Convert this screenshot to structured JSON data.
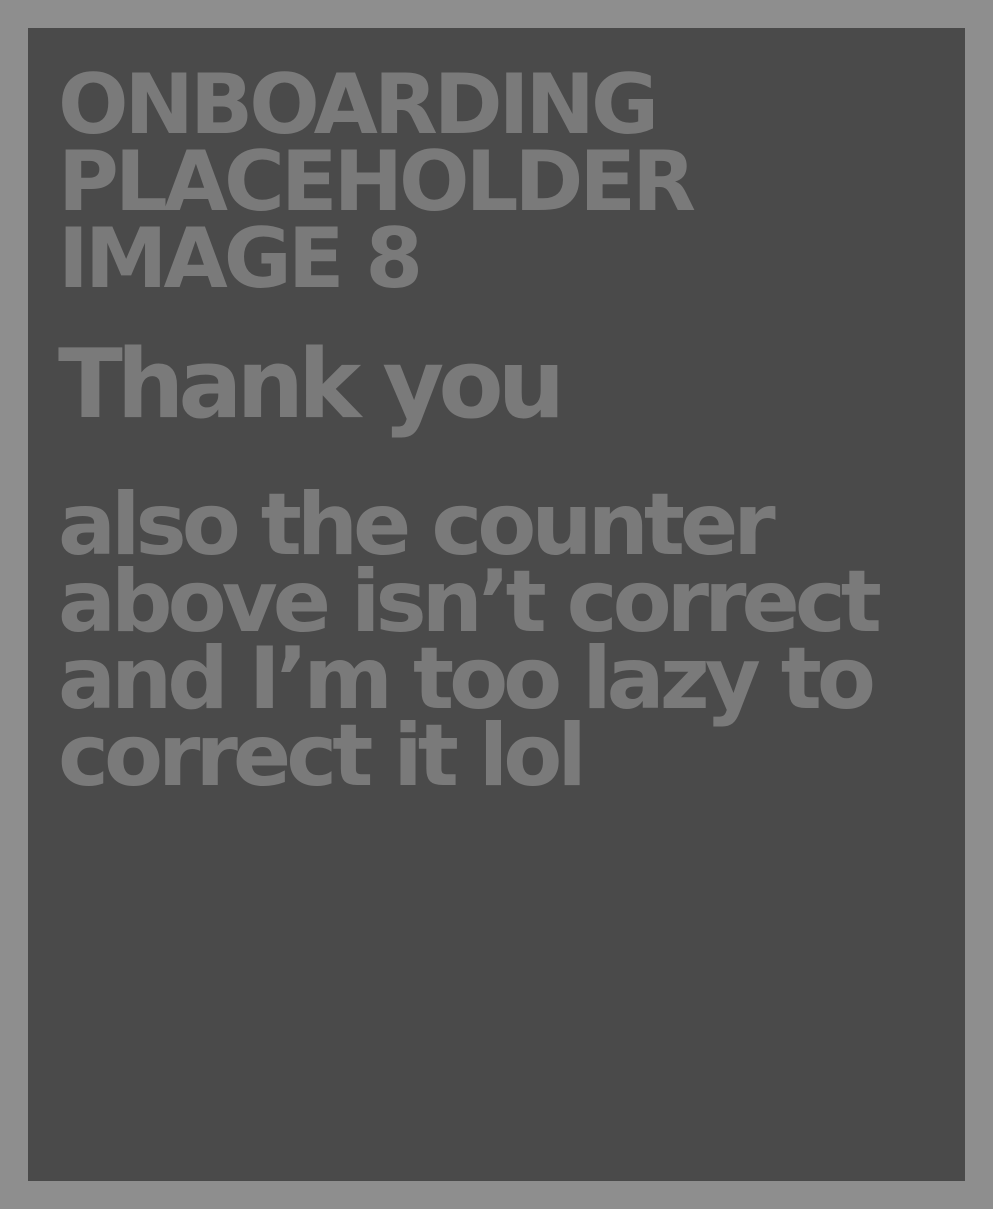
{
  "placeholder": {
    "heading_lines": [
      "ONBOARDING",
      "PLACEHOLDER",
      "IMAGE 8"
    ],
    "thanks": "Thank you",
    "note_lines": [
      "also the counter",
      "above isn’t correct",
      "and I’m too lazy to",
      "correct it lol"
    ]
  },
  "colors": {
    "page_background": "#8e8e8e",
    "panel_background": "#4a4a4a",
    "text": "#7a7a7a"
  }
}
